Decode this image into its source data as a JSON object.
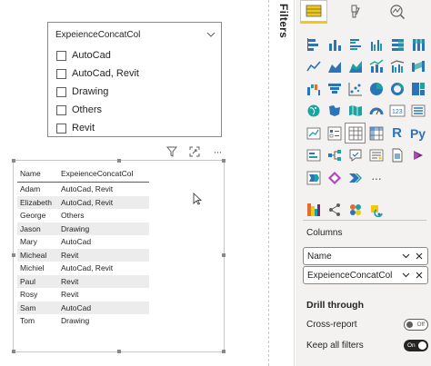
{
  "slicer": {
    "title": "ExpeienceConcatCol",
    "items": [
      "AutoCad",
      "AutoCad, Revit",
      "Drawing",
      "Others",
      "Revit"
    ]
  },
  "table": {
    "headers": [
      "Name",
      "ExpeienceConcatCol"
    ],
    "rows": [
      [
        "Adam",
        "AutoCad, Revit"
      ],
      [
        "Elizabeth",
        "AutoCad, Revit"
      ],
      [
        "George",
        "Others"
      ],
      [
        "Jason",
        "Drawing"
      ],
      [
        "Mary",
        "AutoCad"
      ],
      [
        "Micheal",
        "Revit"
      ],
      [
        "Michiel",
        "AutoCad, Revit"
      ],
      [
        "Paul",
        "Revit"
      ],
      [
        "Rosy",
        "Revit"
      ],
      [
        "Sam",
        "AutoCad"
      ],
      [
        "Tom",
        "Drawing"
      ]
    ]
  },
  "visual_header": {
    "more_label": "···"
  },
  "filters_pane": {
    "label": "Filters"
  },
  "viz_pane": {
    "r_label": "R",
    "py_label": "Py",
    "more_label": "···",
    "columns_label": "Columns",
    "wells": [
      "Name",
      "ExpeienceConcatCol"
    ],
    "drill_through_label": "Drill through",
    "cross_report_label": "Cross-report",
    "cross_report_state": "Off",
    "keep_filters_label": "Keep all filters",
    "keep_filters_state": "On"
  },
  "colors": {
    "accent_yellow": "#f2c811",
    "pane_bg": "#f3f2f1",
    "icon_blue": "#2b74b8",
    "icon_teal": "#1aa3a3",
    "text": "#252423"
  }
}
